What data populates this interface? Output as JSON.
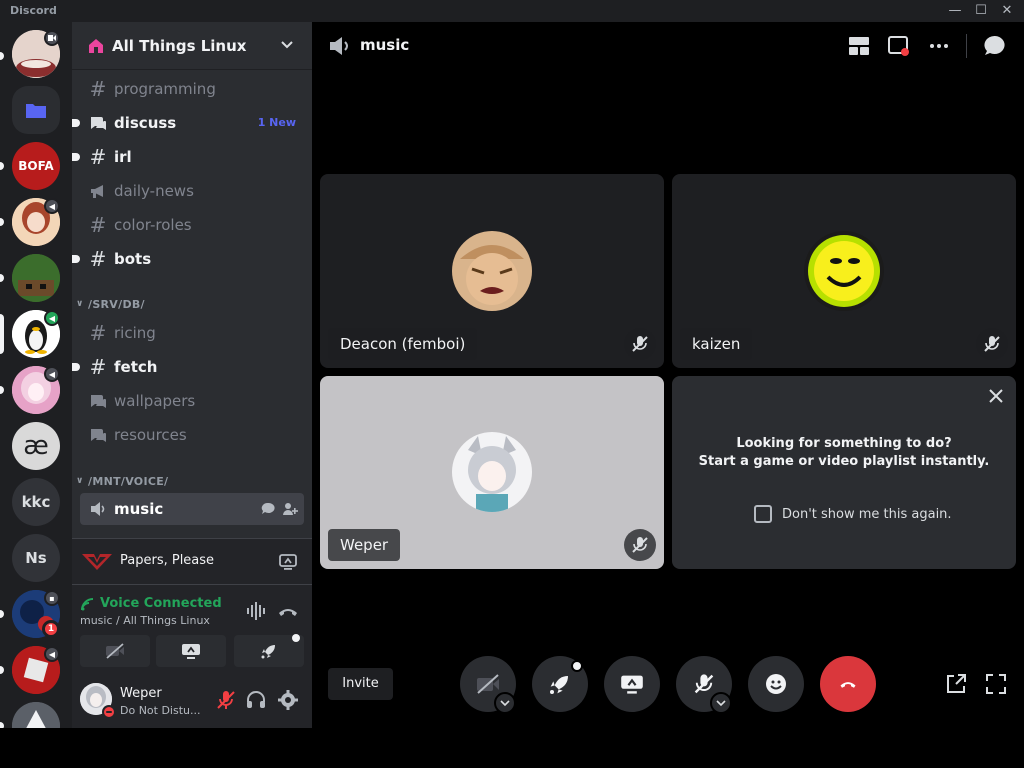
{
  "window": {
    "app_name": "Discord",
    "minimize": "—",
    "maximize": "☐",
    "close": "✕"
  },
  "servers": [
    {
      "label": "",
      "badge": "camera"
    },
    {
      "label": "",
      "badge": ""
    },
    {
      "label": "BOFA",
      "badge": ""
    },
    {
      "label": "",
      "badge": "speaker"
    },
    {
      "label": "",
      "badge": ""
    },
    {
      "label": "",
      "badge": "speaker-green"
    },
    {
      "label": "",
      "badge": "speaker"
    },
    {
      "label": "æ",
      "badge": ""
    },
    {
      "label": "kkc",
      "badge": ""
    },
    {
      "label": "Ns",
      "badge": ""
    },
    {
      "label": "",
      "badge": "calendar",
      "mentions": "1"
    },
    {
      "label": "",
      "badge": "speaker"
    },
    {
      "label": "",
      "badge": ""
    }
  ],
  "guild": {
    "name": "All Things Linux"
  },
  "channels": {
    "programming": "programming",
    "discuss": "discuss",
    "discuss_badge": "1 New",
    "irl": "irl",
    "daily_news": "daily-news",
    "color_roles": "color-roles",
    "bots": "bots",
    "category_db": "/SRV/DB/",
    "ricing": "ricing",
    "fetch": "fetch",
    "wallpapers": "wallpapers",
    "resources": "resources",
    "category_voice": "/MNT/VOICE/",
    "music": "music"
  },
  "activity": {
    "game": "Papers, Please"
  },
  "voice": {
    "status": "Voice Connected",
    "location": "music / All Things Linux"
  },
  "user": {
    "name": "Weper",
    "status": "Do Not Distu..."
  },
  "stage": {
    "title": "music"
  },
  "tiles": [
    {
      "name": "Deacon (femboi)"
    },
    {
      "name": "kaizen"
    },
    {
      "name": "Weper"
    }
  ],
  "activity_tile": {
    "line1": "Looking for something to do?",
    "line2": "Start a game or video playlist instantly.",
    "checkbox": "Don't show me this again."
  },
  "controls": {
    "invite": "Invite"
  },
  "colors": {
    "accent": "#5865f2",
    "voice_connected": "#23a55a",
    "danger": "#da373c",
    "dnd": "#f23f43"
  }
}
